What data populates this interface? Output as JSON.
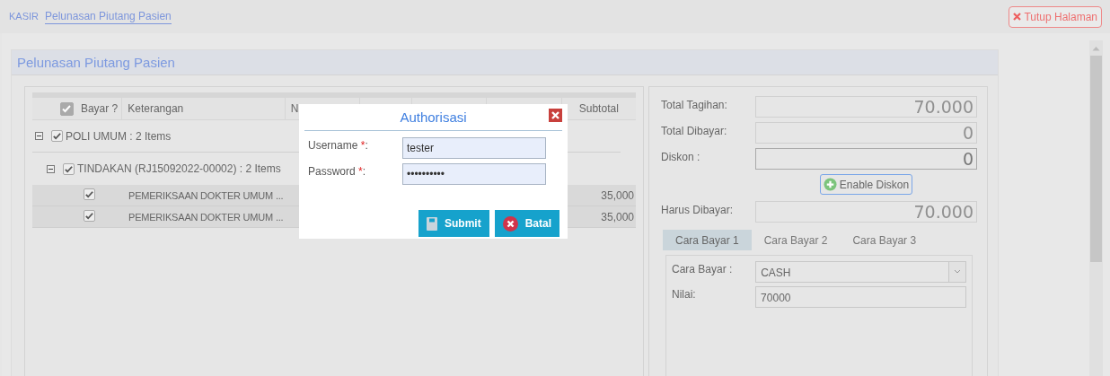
{
  "breadcrumb": [
    {
      "label": "KASIR",
      "kind": "plain"
    },
    {
      "label": "Pelunasan Piutang Pasien",
      "kind": "link"
    }
  ],
  "close_page_button": {
    "label": "Tutup Halaman"
  },
  "panel": {
    "title": "Pelunasan Piutang Pasien"
  },
  "grid": {
    "header_checked": true,
    "columns": [
      {
        "label": "Bayar ?"
      },
      {
        "label": "Keterangan"
      },
      {
        "label": "N"
      },
      {},
      {},
      {},
      {
        "label": "Subtotal"
      }
    ],
    "groups": [
      {
        "label": "POLI UMUM : 2 Items",
        "expanded": true,
        "checked": true,
        "children": [
          {
            "label": "TINDAKAN (RJ15092022-00002) : 2 Items",
            "expanded": true,
            "checked": true,
            "rows": [
              {
                "checked": true,
                "keterangan": "PEMERIKSAAN DOKTER UMUM ...",
                "subtotal": "35,000"
              },
              {
                "checked": true,
                "keterangan": "PEMERIKSAAN DOKTER UMUM ...",
                "subtotal": "35,000"
              }
            ]
          }
        ]
      }
    ]
  },
  "summary": [
    {
      "kind": "readonly",
      "label": "Total Tagihan:",
      "value": "70.000"
    },
    {
      "kind": "readonly",
      "label": "Total Dibayar:",
      "value": "0"
    },
    {
      "kind": "editable",
      "label": "Diskon :",
      "value": "0"
    },
    {
      "kind": "button",
      "label": "Enable Diskon"
    },
    {
      "kind": "readonly",
      "label": "Harus Dibayar:",
      "value": "70.000"
    }
  ],
  "payment_tabs": [
    {
      "label": "Cara Bayar 1",
      "selected": true
    },
    {
      "label": "Cara Bayar 2",
      "selected": false
    },
    {
      "label": "Cara Bayar 3",
      "selected": false
    }
  ],
  "payment": {
    "method_label": "Cara Bayar :",
    "method": "CASH",
    "amount_label": "Nilai:",
    "amount": "70000"
  },
  "dialog": {
    "title": "Authorisasi",
    "fields": [
      {
        "label": "Username",
        "required_mark": "*",
        "suffix": ":",
        "value": "tester"
      },
      {
        "label": "Password",
        "required_mark": "*",
        "suffix": ":",
        "value": "••••••••••"
      }
    ],
    "buttons": [
      {
        "kind": "submit",
        "label": "Submit"
      },
      {
        "kind": "cancel",
        "label": "Batal"
      }
    ]
  }
}
